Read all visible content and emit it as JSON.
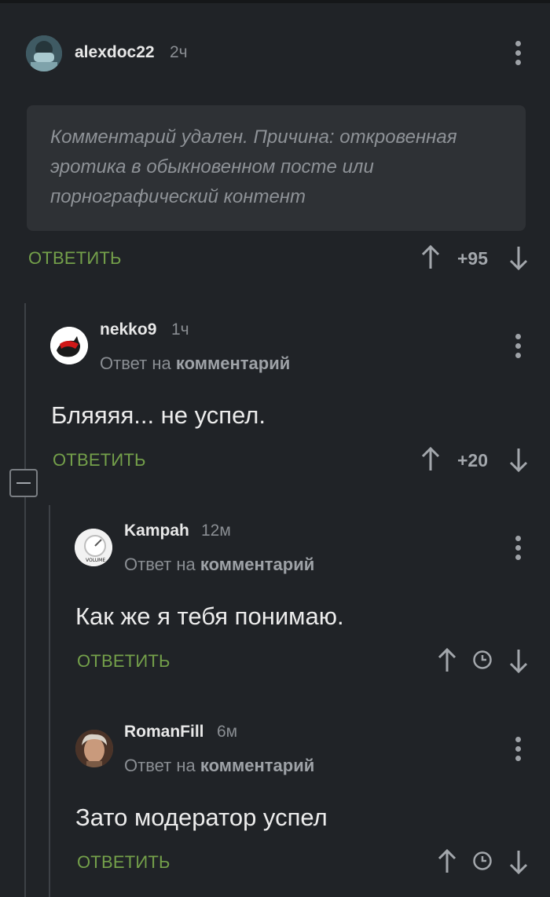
{
  "comments": [
    {
      "username": "alexdoc22",
      "time": "2ч",
      "deleted_text": "Комментарий удален. Причина: откровенная эротика в обыкновенном посте или порнографический контент",
      "reply_label": "ОТВЕТИТЬ",
      "rating": "+95"
    },
    {
      "username": "nekko9",
      "time": "1ч",
      "reply_to_prefix": "Ответ на",
      "reply_to_link": "комментарий",
      "text": "Бляяяя... не успел.",
      "reply_label": "ОТВЕТИТЬ",
      "rating": "+20"
    },
    {
      "username": "Kampah",
      "time": "12м",
      "reply_to_prefix": "Ответ на",
      "reply_to_link": "комментарий",
      "text": "Как же я тебя понимаю.",
      "reply_label": "ОТВЕТИТЬ",
      "rating_icon": "clock-icon",
      "avatar_label": "VOLUME"
    },
    {
      "username": "RomanFill",
      "time": "6м",
      "reply_to_prefix": "Ответ на",
      "reply_to_link": "комментарий",
      "text": "Зато модератор успел",
      "reply_label": "ОТВЕТИТЬ",
      "rating_icon": "clock-icon"
    }
  ],
  "colors": {
    "background": "#202327",
    "accent_green": "#74a04a",
    "muted_text": "#8a8e93",
    "deleted_box": "#2e3135"
  }
}
